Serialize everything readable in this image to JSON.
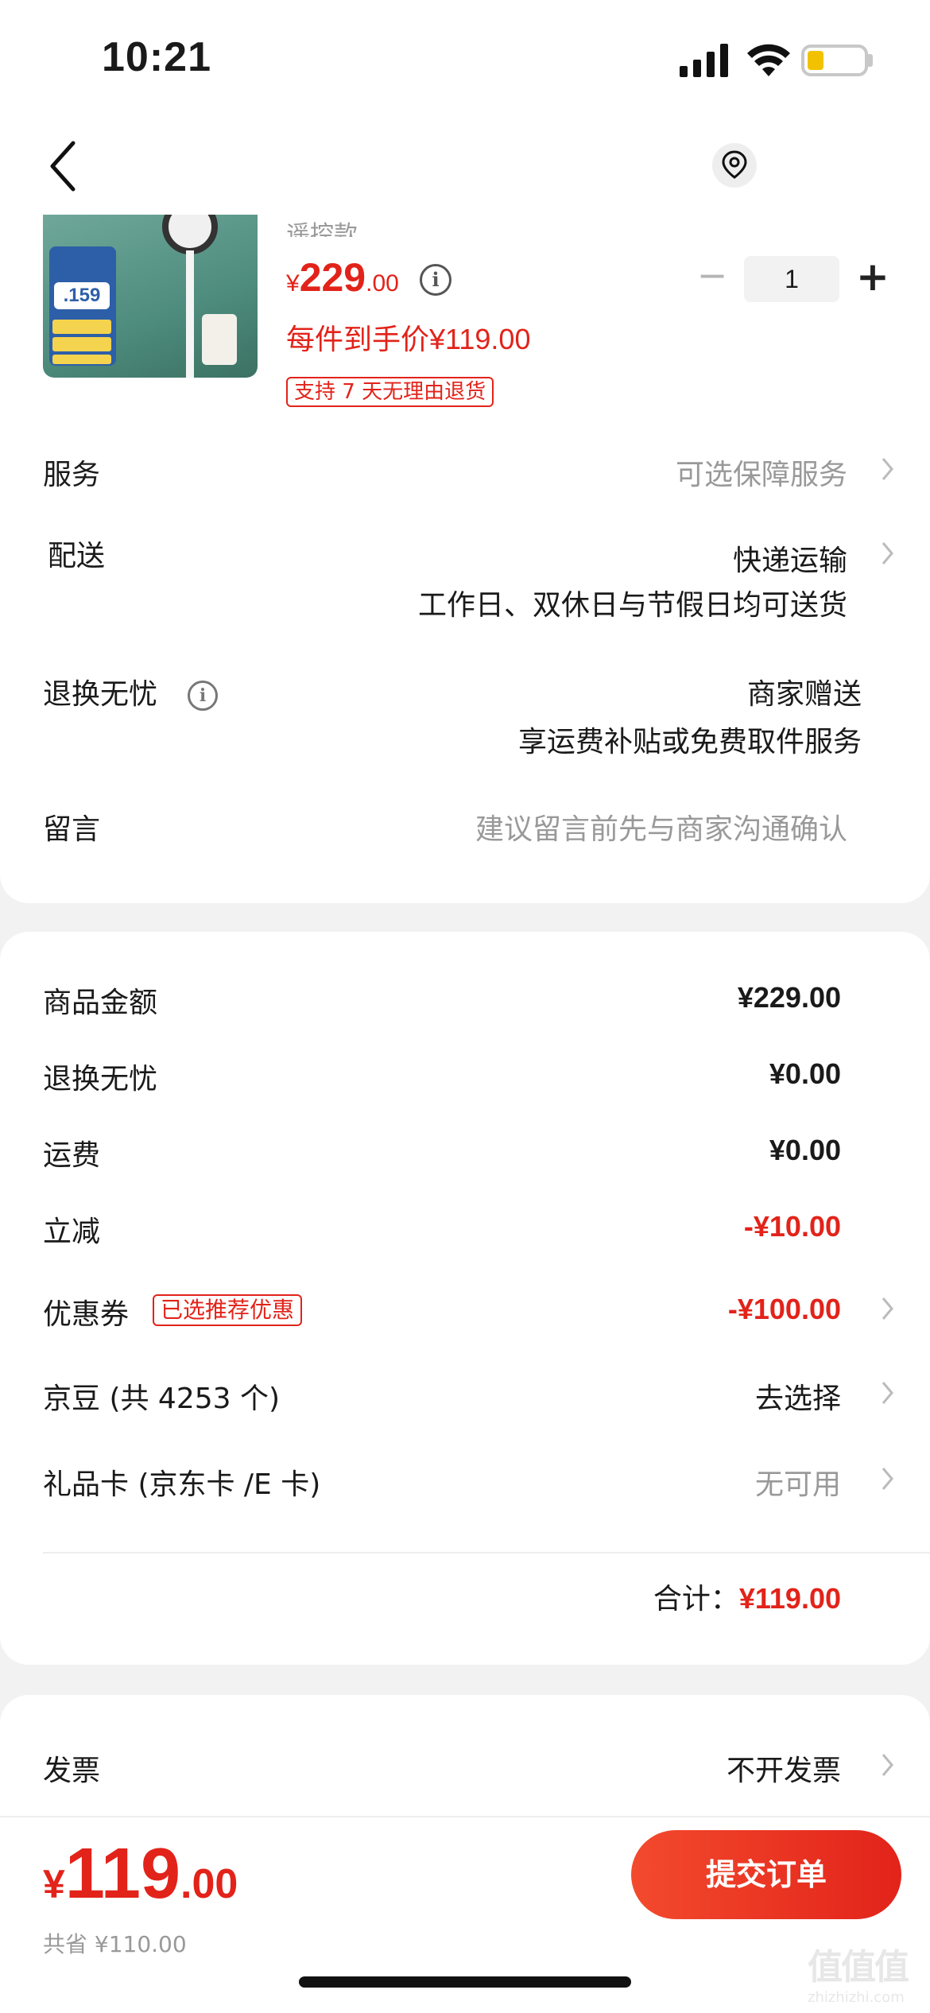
{
  "status_bar": {
    "time": "10:21"
  },
  "product": {
    "subtitle": "遥控款",
    "image_price": ".159",
    "price_symbol": "¥",
    "price_int": "229",
    "price_dec": ".00",
    "hand_price": "每件到手价¥119.00",
    "return_tag": "支持 7 天无理由退货",
    "quantity": "1",
    "minus": "−",
    "plus": "+"
  },
  "rows": {
    "service": {
      "label": "服务",
      "value": "可选保障服务"
    },
    "delivery": {
      "label": "配送",
      "value": "快递运输",
      "detail": "工作日、双休日与节假日均可送货"
    },
    "worry_free": {
      "label": "退换无忧",
      "value": "商家赠送",
      "detail": "享运费补贴或免费取件服务"
    },
    "message": {
      "label": "留言",
      "placeholder": "建议留言前先与商家沟通确认"
    }
  },
  "amounts": {
    "goods": {
      "label": "商品金额",
      "value": "¥229.00"
    },
    "worry": {
      "label": "退换无忧",
      "value": "¥0.00"
    },
    "shipping": {
      "label": "运费",
      "value": "¥0.00"
    },
    "discount": {
      "label": "立减",
      "value": "-¥10.00"
    },
    "coupon": {
      "label": "优惠券",
      "tag": "已选推荐优惠",
      "value": "-¥100.00"
    },
    "jingdou": {
      "label": "京豆 (共 4253 个)",
      "value": "去选择"
    },
    "giftcard": {
      "label": "礼品卡 (京东卡 /E 卡)",
      "value": "无可用"
    },
    "total_label": "合计：",
    "total_value": "¥119.00"
  },
  "invoice": {
    "label": "发票",
    "value": "不开发票"
  },
  "footer": {
    "yen": "¥",
    "price_int": "119",
    "price_dec": ".00",
    "saved": "共省 ¥110.00",
    "submit": "提交订单"
  },
  "watermark": {
    "logo": "值值值",
    "site": "zhizhizhi.com"
  },
  "colors": {
    "accent": "#e2231a",
    "background": "#f2f2f2"
  }
}
